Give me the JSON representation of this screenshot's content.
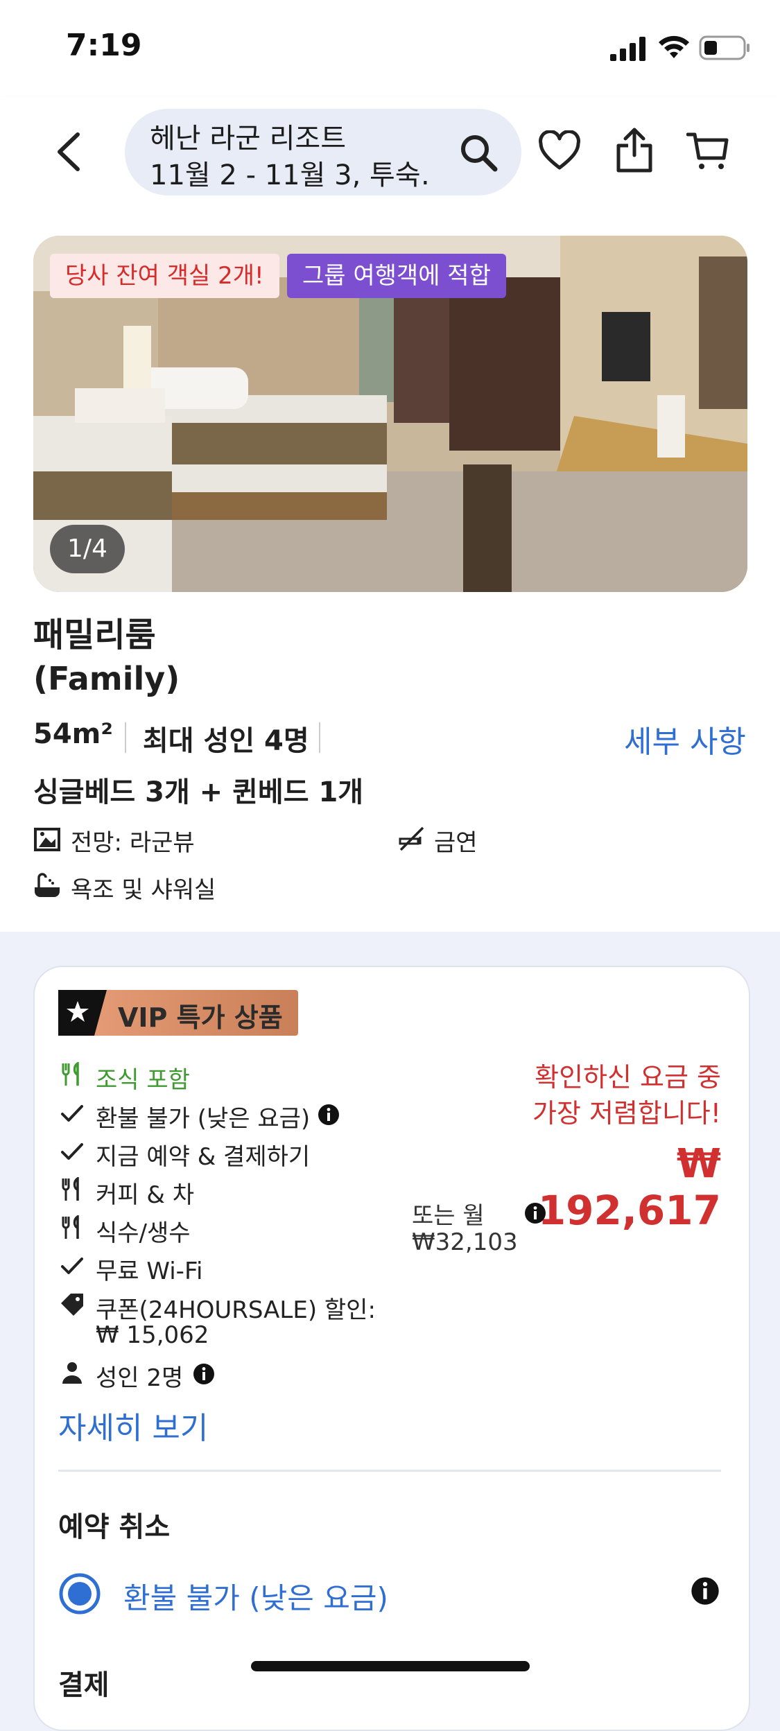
{
  "status_bar": {
    "time": "7:19"
  },
  "header": {
    "back_icon": "chevron-left-icon",
    "search_title": "헤난 라군 리조트",
    "search_subtitle": "11월 2 - 11월 3, 투숙…",
    "search_icon": "search-icon",
    "favorite_icon": "heart-icon",
    "share_icon": "share-icon",
    "cart_icon": "cart-icon"
  },
  "room": {
    "badges": [
      "당사 잔여 객실 2개!",
      "그룹 여행객에 적합"
    ],
    "photo_counter": "1/4",
    "title": "패밀리룸",
    "subtitle": "(Family)",
    "size": "54m²",
    "capacity": "최대 성인 4명",
    "details_link": "세부 사항",
    "beds": "싱글베드 3개 + 퀸베드 1개",
    "features": [
      {
        "icon": "view-icon",
        "label": "전망: 라군뷰"
      },
      {
        "icon": "no-smoking-icon",
        "label": "금연"
      },
      {
        "icon": "bathtub-shower-icon",
        "label": "욕조 및 샤워실"
      }
    ]
  },
  "offer": {
    "vip_label": "VIP 특가 상품",
    "inclusions": [
      {
        "icon": "fork-knife-icon",
        "label": "조식 포함",
        "color": "#3f9a2f"
      },
      {
        "icon": "check-icon",
        "label": "환불 불가 (낮은 요금)",
        "info": true
      },
      {
        "icon": "check-icon",
        "label": "지금 예약 & 결제하기"
      },
      {
        "icon": "fork-knife-icon",
        "label": "커피 & 차"
      },
      {
        "icon": "fork-knife-icon",
        "label": "식수/생수"
      },
      {
        "icon": "check-icon",
        "label": "무료 Wi-Fi"
      },
      {
        "icon": "tag-icon",
        "label": "쿠폰(24HOURSALE) 할인:",
        "label2": "₩ 15,062"
      },
      {
        "icon": "person-icon",
        "label": "성인 2명",
        "info": true
      }
    ],
    "price_note_line1": "확인하신 요금 중",
    "price_note_line2": "가장 저렴합니다!",
    "price": "₩ 192,617",
    "monthly_label": "또는 월",
    "monthly_value": "₩32,103",
    "details_link": "자세히 보기",
    "cancel_heading": "예약 취소",
    "cancel_option": "환불 불가 (낮은 요금)",
    "payment_heading": "결제"
  },
  "colors": {
    "link": "#2f6ed2",
    "price": "#d13030",
    "accent_purple": "#7c4fd1",
    "include_green": "#3f9a2f"
  }
}
